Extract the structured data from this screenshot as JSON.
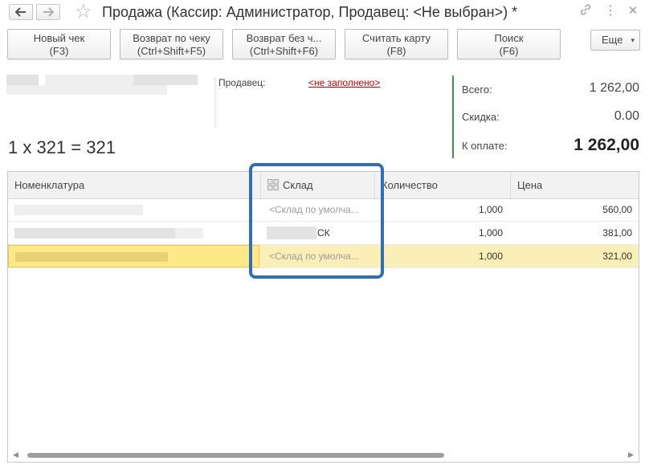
{
  "window": {
    "title": "Продажа (Кассир: Администратор, Продавец: <Не выбран>) *",
    "back_icon": "arrow-left-icon",
    "forward_icon": "arrow-right-icon",
    "favorite_icon": "star-icon",
    "link_icon": "link-icon",
    "menu_icon": "more-vertical-icon",
    "close_icon": "close-icon"
  },
  "toolbar": {
    "buttons": [
      {
        "line1": "Новый чек",
        "line2": "(F3)"
      },
      {
        "line1": "Возврат по чеку",
        "line2": "(Ctrl+Shift+F5)"
      },
      {
        "line1": "Возврат без ч...",
        "line2": "(Ctrl+Shift+F6)"
      },
      {
        "line1": "Считать карту",
        "line2": "(F8)"
      },
      {
        "line1": "Поиск",
        "line2": "(F6)"
      }
    ],
    "more_label": "Еще",
    "more_caret": "▾"
  },
  "info": {
    "seller_label": "Продавец:",
    "seller_value": "<не заполнено>",
    "formula": "1 x 321 = 321"
  },
  "totals": {
    "total_label": "Всего:",
    "total_value": "1 262,00",
    "discount_label": "Скидка:",
    "discount_value": "0.00",
    "pay_label": "К оплате:",
    "pay_value": "1 262,00",
    "accent_color": "#3f9a3f"
  },
  "table": {
    "columns": [
      "Номенклатура",
      "Склад",
      "Количество",
      "Цена"
    ],
    "rows": [
      {
        "warehouse": "<Склад по умолча...",
        "quantity": "1,000",
        "price": "560,00",
        "selected": false
      },
      {
        "warehouse": "СК",
        "quantity": "1,000",
        "price": "381,00",
        "selected": false
      },
      {
        "warehouse": "<Склад по умолча...",
        "quantity": "1,000",
        "price": "321,00",
        "selected": true
      }
    ]
  },
  "highlight_color": "#2f6fb2",
  "selection_color": "#fbefb8"
}
